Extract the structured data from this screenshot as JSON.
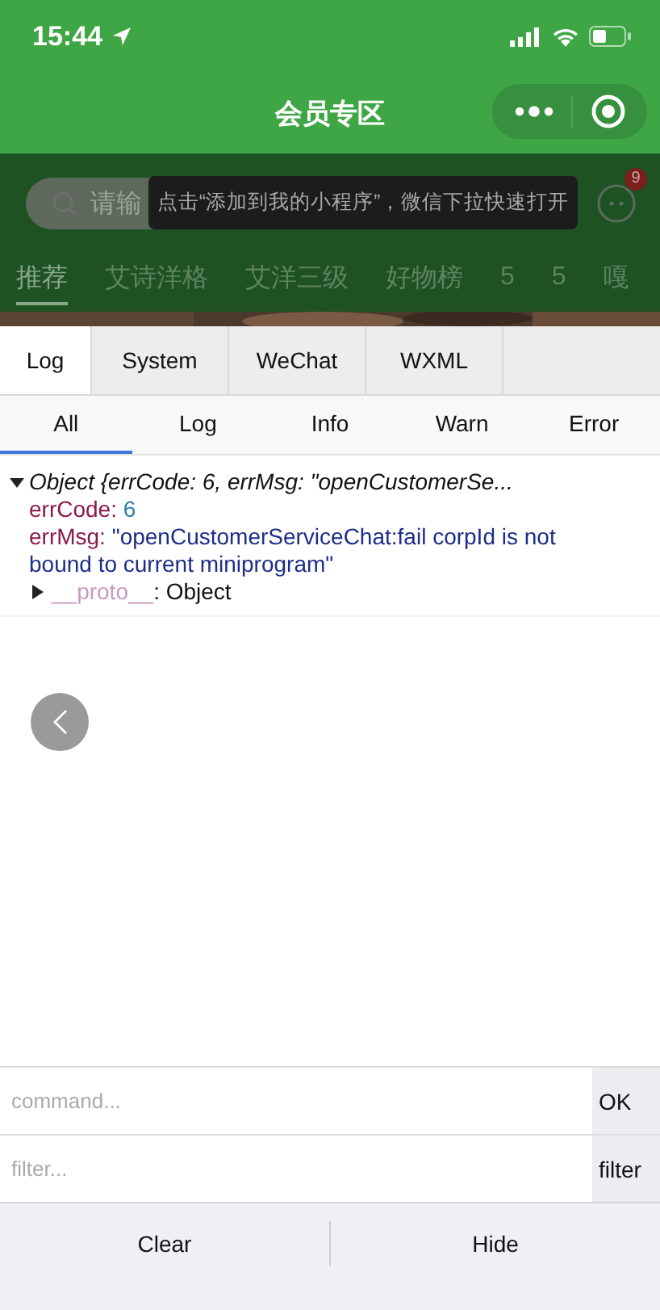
{
  "status_bar": {
    "time": "15:44"
  },
  "nav_bar": {
    "title": "会员专区"
  },
  "page": {
    "search": {
      "placeholder": "请输"
    },
    "chat_badge": "9",
    "tooltip": "点击“添加到我的小程序”，微信下拉快速打开",
    "tabs": [
      {
        "label": "推荐",
        "selected": true
      },
      {
        "label": "艾诗洋格",
        "selected": false
      },
      {
        "label": "艾洋三级",
        "selected": false
      },
      {
        "label": "好物榜",
        "selected": false
      },
      {
        "label": "5",
        "selected": false
      },
      {
        "label": "5",
        "selected": false
      },
      {
        "label": "嘎",
        "selected": false
      }
    ]
  },
  "console": {
    "tabs": [
      {
        "label": "Log",
        "selected": true
      },
      {
        "label": "System",
        "selected": false
      },
      {
        "label": "WeChat",
        "selected": false
      },
      {
        "label": "WXML",
        "selected": false
      }
    ],
    "filters": [
      {
        "label": "All",
        "selected": true
      },
      {
        "label": "Log",
        "selected": false
      },
      {
        "label": "Info",
        "selected": false
      },
      {
        "label": "Warn",
        "selected": false
      },
      {
        "label": "Error",
        "selected": false
      }
    ],
    "entry": {
      "summary": "Object {errCode: 6, errMsg: \"openCustomerSe...",
      "expanded": true,
      "properties": [
        {
          "key": "errCode:",
          "value": "6",
          "kind": "number"
        },
        {
          "key": "errMsg:",
          "value": "\"openCustomerServiceChat:fail corpId is not bound to current miniprogram\"",
          "kind": "string"
        }
      ],
      "proto": {
        "key": "__proto__",
        "value": ": Object"
      }
    },
    "command": {
      "placeholder": "command...",
      "button": "OK"
    },
    "filter": {
      "placeholder": "filter...",
      "button": "filter"
    },
    "buttons": [
      "Clear",
      "Hide"
    ]
  }
}
